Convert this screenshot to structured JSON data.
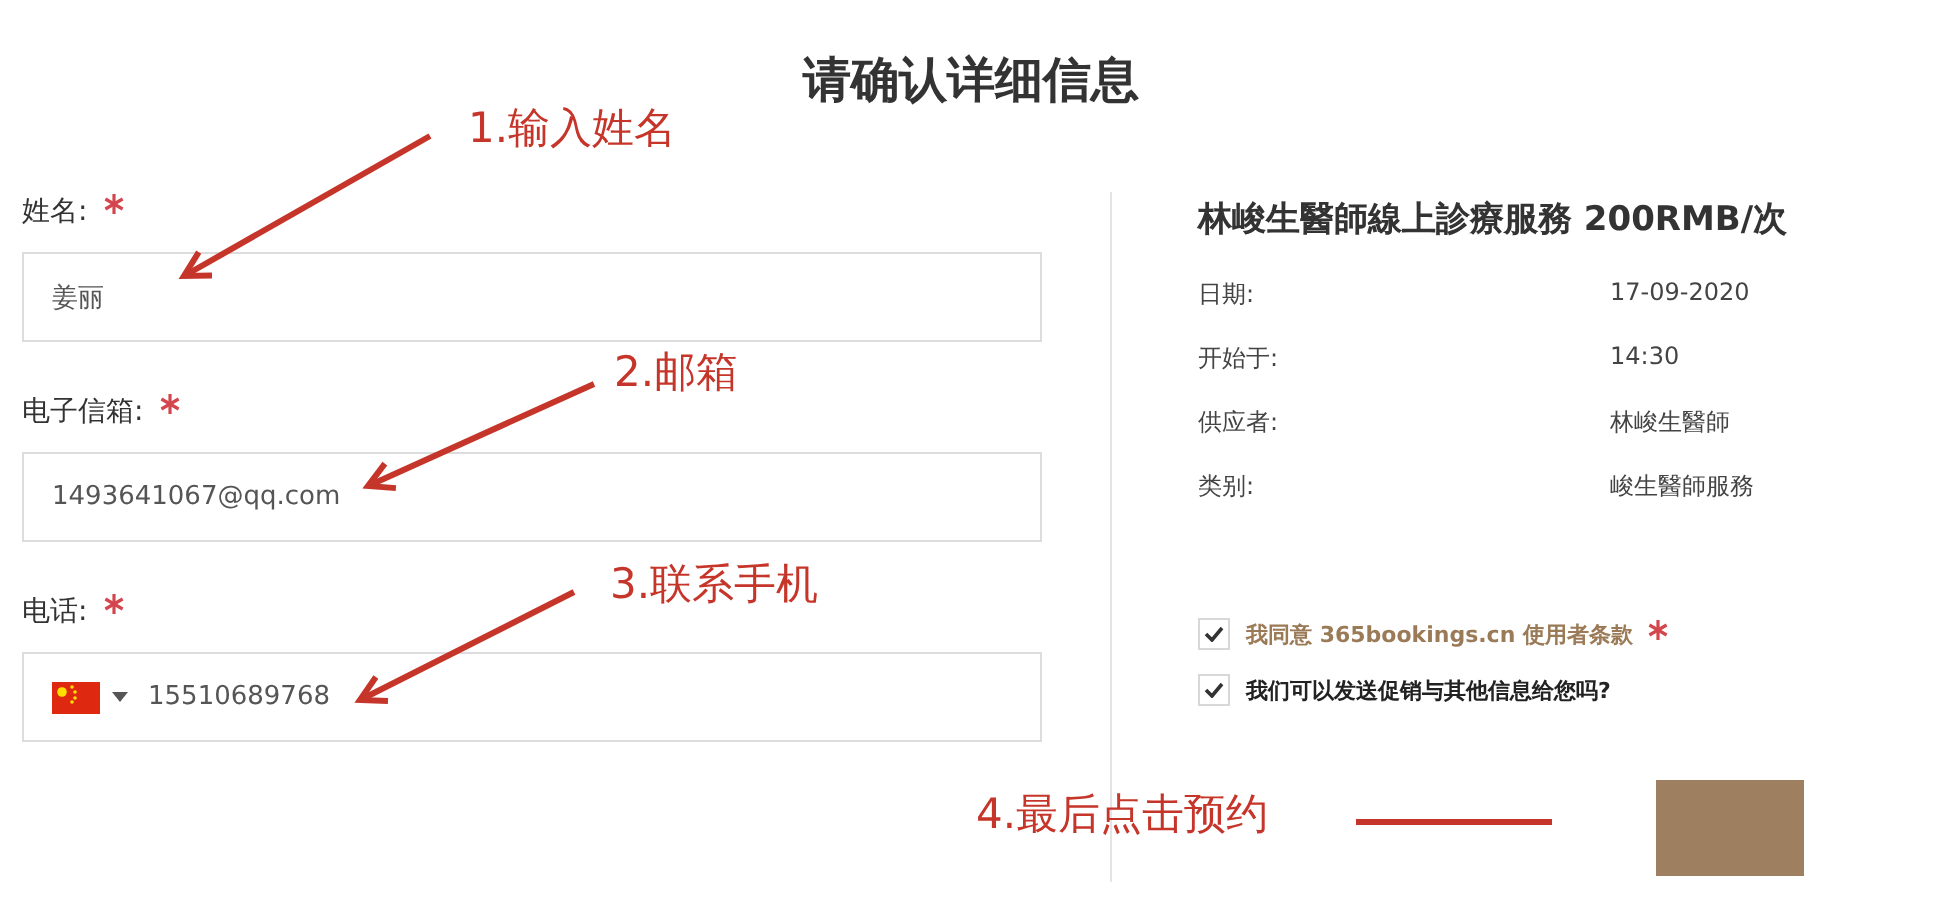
{
  "title": "请确认详细信息",
  "fields": [
    {
      "label": "姓名:",
      "required": true,
      "kind": "text",
      "value": "姜丽"
    },
    {
      "label": "电子信箱:",
      "required": true,
      "kind": "text",
      "value": "1493641067@qq.com"
    },
    {
      "label": "电话:",
      "required": true,
      "kind": "phone",
      "value": "15510689768"
    }
  ],
  "summary": {
    "title": "林峻生醫師線上診療服務 200RMB/次",
    "rows": [
      {
        "label": "日期:",
        "value": "17-09-2020"
      },
      {
        "label": "开始于:",
        "value": "14:30"
      },
      {
        "label": "供应者:",
        "value": "林峻生醫師"
      },
      {
        "label": "类别:",
        "value": "峻生醫師服務"
      }
    ]
  },
  "consents": [
    {
      "label": "我同意 365bookings.cn 使用者条款",
      "checked": true,
      "required": true,
      "kind": "terms"
    },
    {
      "label": "我们可以发送促销与其他信息给您吗?",
      "checked": true,
      "required": false,
      "kind": "plain"
    }
  ],
  "annotations": [
    "1.输入姓名",
    "2.邮箱",
    "3.联系手机",
    "4.最后点击预约"
  ]
}
